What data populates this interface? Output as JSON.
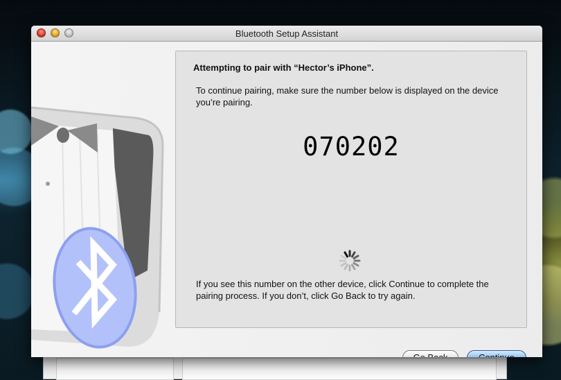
{
  "window": {
    "title": "Bluetooth Setup Assistant"
  },
  "pairing": {
    "heading": "Attempting to pair with “Hector’s iPhone”.",
    "instruction": "To continue pairing, make sure the number below is displayed on the device you’re pairing.",
    "passkey": "070202",
    "footer_text": "If you see this number on the other device, click Continue to complete the pairing process. If you don’t, click Go Back to try again."
  },
  "buttons": {
    "go_back": "Go Back",
    "continue": "Continue"
  },
  "icons": {
    "art": "tuxedo-illustration",
    "bluetooth": "bluetooth-icon",
    "spinner": "progress-spinner-icon"
  },
  "colors": {
    "default_button": "#7fb4ec",
    "bluetooth_badge": "#9aaaf0"
  }
}
